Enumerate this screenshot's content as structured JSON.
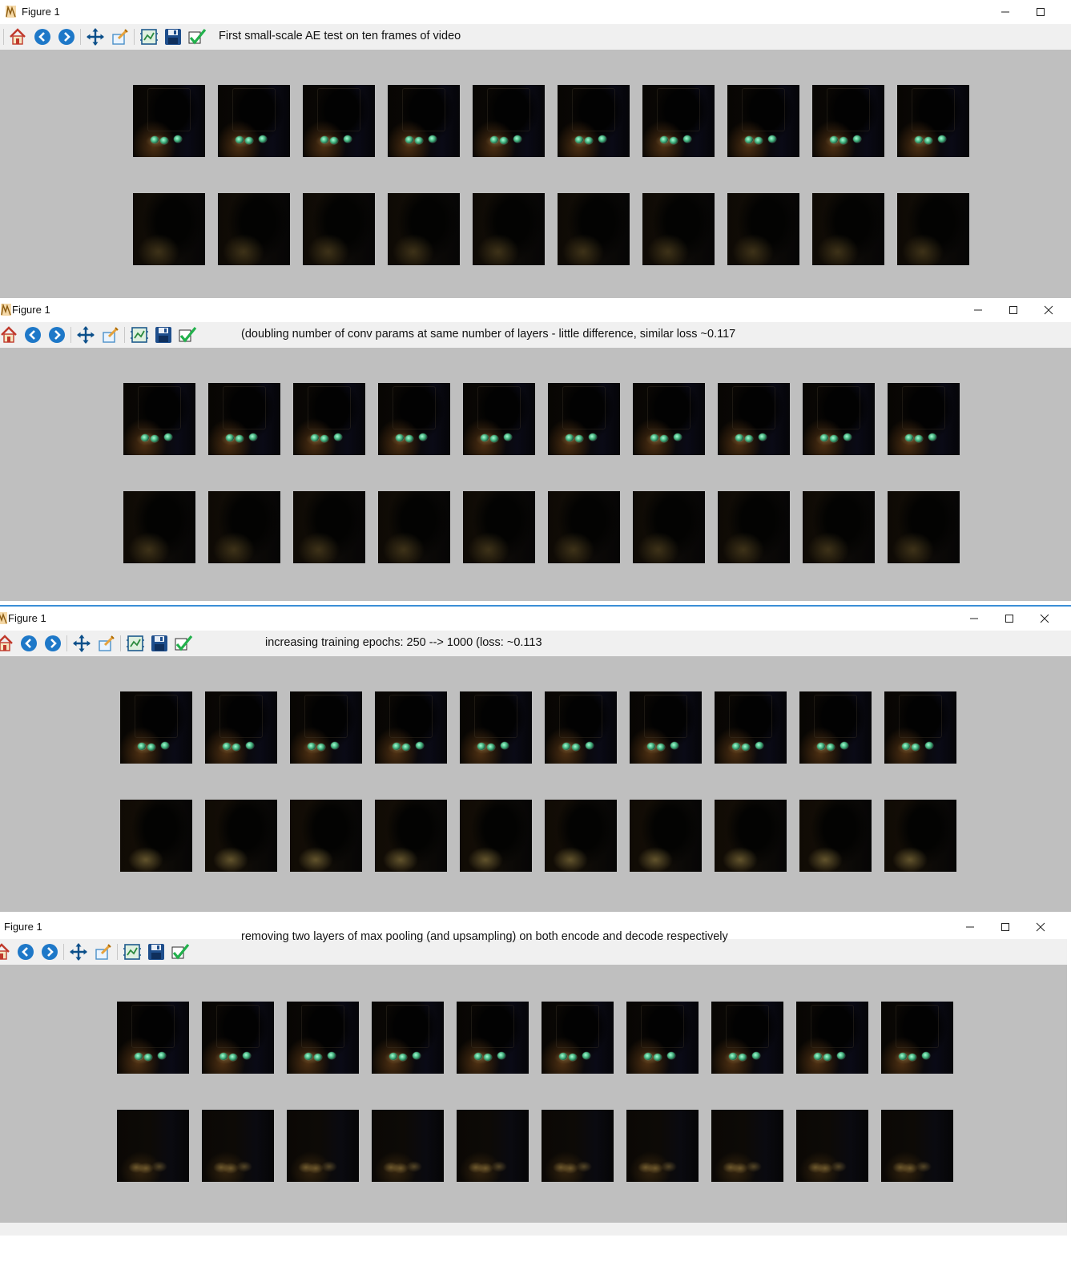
{
  "windows": [
    {
      "title": "Figure 1",
      "toolbar_label": "First small-scale AE test on ten frames of video",
      "controls": [
        "minimize",
        "maximize"
      ]
    },
    {
      "title": "Figure 1",
      "toolbar_label": "(doubling number of conv params at same number of layers - little difference, similar loss ~0.117",
      "controls": [
        "minimize",
        "maximize",
        "close"
      ]
    },
    {
      "title": "Figure 1",
      "toolbar_label": "increasing training epochs: 250 --> 1000 (loss: ~0.113",
      "controls": [
        "minimize",
        "maximize",
        "close"
      ]
    },
    {
      "title": "Figure 1",
      "toolbar_label": "removing two layers of max pooling (and upsampling) on both encode and decode respectively",
      "controls": [
        "minimize",
        "maximize",
        "close"
      ]
    }
  ],
  "toolbar_icons": [
    "home-icon",
    "back-icon",
    "forward-icon",
    "pan-icon",
    "zoom-icon",
    "configure-subplots-icon",
    "save-icon",
    "edit-axes-icon"
  ],
  "grid": {
    "rows": [
      "original",
      "reconstruction"
    ],
    "frames_per_row": 10
  },
  "colors": {
    "canvas": "#bfbfbf",
    "toolbar": "#f0f0f0",
    "titlebar": "#ffffff",
    "icon_blue": "#1e78c8",
    "check_green": "#22b14c"
  }
}
